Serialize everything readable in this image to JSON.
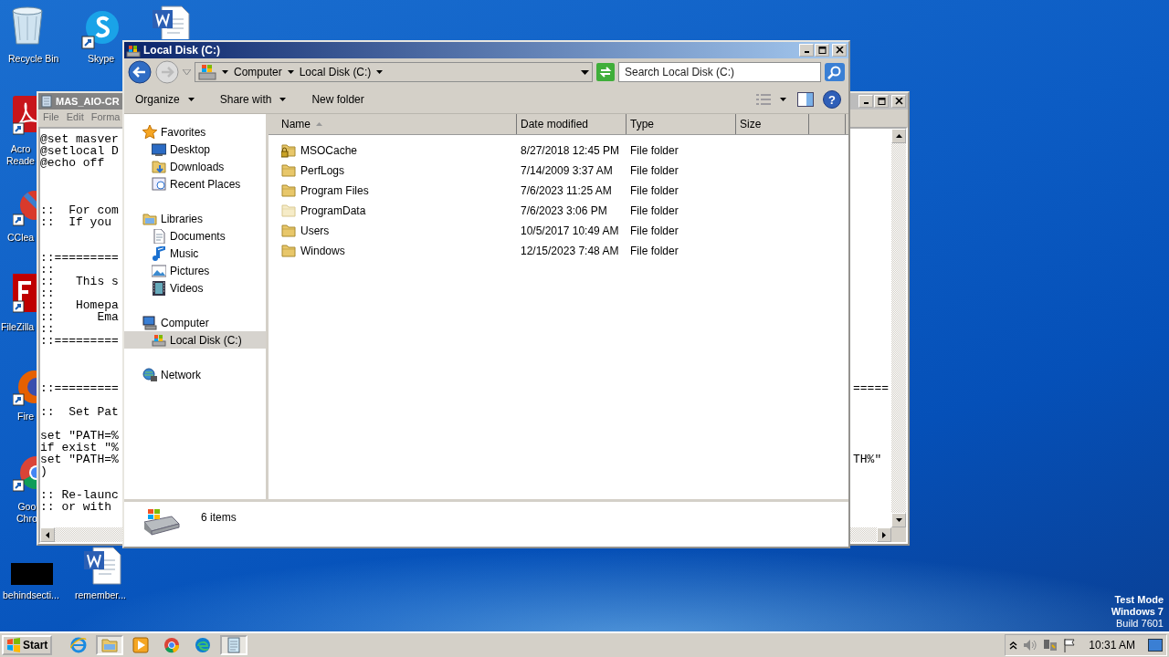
{
  "desktop": {
    "icons": [
      {
        "kind": "recycle",
        "label": "Recycle Bin"
      },
      {
        "kind": "skype",
        "label": "Skype"
      },
      {
        "kind": "word"
      },
      {
        "kind": "acrobat",
        "label": "Acro Reade"
      },
      {
        "kind": "ccleaner",
        "label": "CClea"
      },
      {
        "kind": "filezilla",
        "label": "FileZilla"
      },
      {
        "kind": "firefox",
        "label": "Fire"
      },
      {
        "kind": "chrome",
        "label": "Goo Chro"
      },
      {
        "kind": "black",
        "label": "behindsecti..."
      },
      {
        "kind": "word",
        "label": "remember..."
      }
    ],
    "notice": [
      "Test Mode",
      "Windows 7",
      "Build 7601"
    ]
  },
  "notepad": {
    "title": "MAS_AIO-CR",
    "menu": [
      "File",
      "Edit",
      "Forma"
    ],
    "lines": [
      {
        "kind": "text",
        "text": "@set masver"
      },
      {
        "kind": "text",
        "text": "@setlocal D"
      },
      {
        "kind": "text",
        "text": "@echo off"
      },
      {
        "kind": "blank"
      },
      {
        "kind": "blank"
      },
      {
        "kind": "blank"
      },
      {
        "kind": "text",
        "text": "::  For com"
      },
      {
        "kind": "text",
        "text": "::  If you"
      },
      {
        "kind": "blank"
      },
      {
        "kind": "blank"
      },
      {
        "kind": "text",
        "text": "::========="
      },
      {
        "kind": "text",
        "text": "::"
      },
      {
        "kind": "text",
        "text": "::   This s"
      },
      {
        "kind": "text",
        "text": "::"
      },
      {
        "kind": "text",
        "text": "::   Homepa"
      },
      {
        "kind": "text",
        "text": "::      Ema"
      },
      {
        "kind": "text",
        "text": "::"
      },
      {
        "kind": "text",
        "text": "::========="
      },
      {
        "kind": "blank"
      },
      {
        "kind": "blank"
      },
      {
        "kind": "blank"
      },
      {
        "kind": "text",
        "text": "::=========",
        "right": "====="
      },
      {
        "kind": "blank"
      },
      {
        "kind": "text",
        "text": "::  Set Pat"
      },
      {
        "kind": "blank"
      },
      {
        "kind": "text",
        "text": "set \"PATH=%"
      },
      {
        "kind": "text",
        "text": "if exist \"%"
      },
      {
        "kind": "text",
        "text": "set \"PATH=%",
        "right": "TH%\""
      },
      {
        "kind": "text",
        "text": ")"
      },
      {
        "kind": "blank"
      },
      {
        "kind": "text",
        "text": ":: Re-launc"
      },
      {
        "kind": "text",
        "text": ":: or with"
      }
    ]
  },
  "explorer": {
    "title": "Local Disk (C:)",
    "breadcrumb": [
      "Computer",
      "Local Disk (C:)"
    ],
    "search": {
      "placeholder": "Search Local Disk (C:)"
    },
    "toolbar": [
      {
        "label": "Organize",
        "dropdown": true
      },
      {
        "label": "Share with",
        "dropdown": true
      },
      {
        "label": "New folder",
        "dropdown": false
      }
    ],
    "nav": [
      {
        "kind": "star",
        "label": "Favorites",
        "selected": false,
        "children": [
          {
            "kind": "desktop",
            "label": "Desktop",
            "selected": false
          },
          {
            "kind": "downloads",
            "label": "Downloads",
            "selected": false
          },
          {
            "kind": "recent",
            "label": "Recent Places",
            "selected": false
          }
        ]
      },
      {
        "kind": "libraries",
        "label": "Libraries",
        "selected": false,
        "children": [
          {
            "kind": "documents",
            "label": "Documents",
            "selected": false
          },
          {
            "kind": "music",
            "label": "Music",
            "selected": false
          },
          {
            "kind": "pictures",
            "label": "Pictures",
            "selected": false
          },
          {
            "kind": "videos",
            "label": "Videos",
            "selected": false
          }
        ]
      },
      {
        "kind": "computer",
        "label": "Computer",
        "selected": false,
        "children": [
          {
            "kind": "drive",
            "label": "Local Disk (C:)",
            "selected": true
          }
        ]
      },
      {
        "kind": "network",
        "label": "Network",
        "selected": false
      }
    ],
    "columns": [
      {
        "label": "Name",
        "sorted": true
      },
      {
        "label": "Date modified",
        "sorted": false
      },
      {
        "label": "Type",
        "sorted": false
      },
      {
        "label": "Size",
        "sorted": false
      }
    ],
    "rows": [
      {
        "kind": "locked",
        "name": "MSOCache",
        "date": "8/27/2018 12:45 PM",
        "type": "File folder"
      },
      {
        "kind": "folder",
        "name": "PerfLogs",
        "date": "7/14/2009 3:37 AM",
        "type": "File folder"
      },
      {
        "kind": "folder",
        "name": "Program Files",
        "date": "7/6/2023 11:25 AM",
        "type": "File folder"
      },
      {
        "kind": "hidden",
        "name": "ProgramData",
        "date": "7/6/2023 3:06 PM",
        "type": "File folder"
      },
      {
        "kind": "folder",
        "name": "Users",
        "date": "10/5/2017 10:49 AM",
        "type": "File folder"
      },
      {
        "kind": "folder",
        "name": "Windows",
        "date": "12/15/2023 7:48 AM",
        "type": "File folder"
      }
    ],
    "help": "?",
    "status": "6 items"
  },
  "taskbar": {
    "start": "Start",
    "apps": [
      {
        "kind": "ie",
        "active": false
      },
      {
        "kind": "explorer",
        "active": true
      },
      {
        "kind": "media",
        "active": false
      },
      {
        "kind": "chrome",
        "active": false
      },
      {
        "kind": "edge",
        "active": false
      },
      {
        "kind": "notepad",
        "active": true
      }
    ],
    "clock": "10:31 AM"
  }
}
